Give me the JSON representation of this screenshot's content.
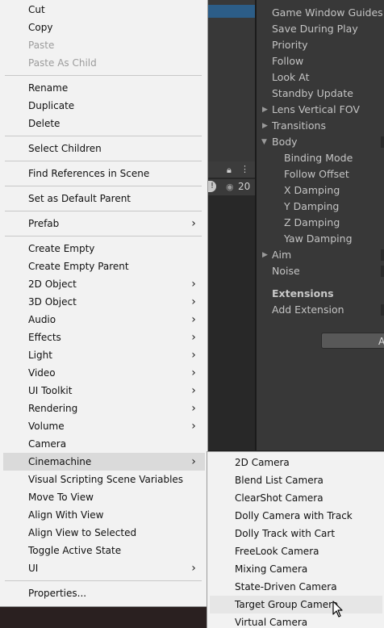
{
  "hierarchy": {
    "visible_count": "20"
  },
  "inspector": {
    "rows": [
      {
        "label": "Game Window Guides"
      },
      {
        "label": "Save During Play"
      },
      {
        "label": "Priority"
      },
      {
        "label": "Follow"
      },
      {
        "label": "Look At"
      },
      {
        "label": "Standby Update"
      },
      {
        "label": "Lens Vertical FOV"
      },
      {
        "label": "Transitions"
      },
      {
        "label": "Body"
      },
      {
        "label": "Binding Mode"
      },
      {
        "label": "Follow Offset"
      },
      {
        "label": "X Damping"
      },
      {
        "label": "Y Damping"
      },
      {
        "label": "Z Damping"
      },
      {
        "label": "Yaw Damping"
      },
      {
        "label": "Aim"
      },
      {
        "label": "Noise"
      },
      {
        "label": "Extensions"
      },
      {
        "label": "Add Extension"
      }
    ],
    "add_button_label": "A"
  },
  "context_menu": {
    "items": [
      {
        "label": "Cut"
      },
      {
        "label": "Copy"
      },
      {
        "label": "Paste"
      },
      {
        "label": "Paste As Child"
      },
      {
        "label": "Rename"
      },
      {
        "label": "Duplicate"
      },
      {
        "label": "Delete"
      },
      {
        "label": "Select Children"
      },
      {
        "label": "Find References in Scene"
      },
      {
        "label": "Set as Default Parent"
      },
      {
        "label": "Prefab"
      },
      {
        "label": "Create Empty"
      },
      {
        "label": "Create Empty Parent"
      },
      {
        "label": "2D Object"
      },
      {
        "label": "3D Object"
      },
      {
        "label": "Audio"
      },
      {
        "label": "Effects"
      },
      {
        "label": "Light"
      },
      {
        "label": "Video"
      },
      {
        "label": "UI Toolkit"
      },
      {
        "label": "Rendering"
      },
      {
        "label": "Volume"
      },
      {
        "label": "Camera"
      },
      {
        "label": "Cinemachine"
      },
      {
        "label": "Visual Scripting Scene Variables"
      },
      {
        "label": "Move To View"
      },
      {
        "label": "Align With View"
      },
      {
        "label": "Align View to Selected"
      },
      {
        "label": "Toggle Active State"
      },
      {
        "label": "UI"
      },
      {
        "label": "Properties..."
      }
    ]
  },
  "cinemachine_submenu": {
    "items": [
      {
        "label": "2D Camera"
      },
      {
        "label": "Blend List Camera"
      },
      {
        "label": "ClearShot Camera"
      },
      {
        "label": "Dolly Camera with Track"
      },
      {
        "label": "Dolly Track with Cart"
      },
      {
        "label": "FreeLook Camera"
      },
      {
        "label": "Mixing Camera"
      },
      {
        "label": "State-Driven Camera"
      },
      {
        "label": "Target Group Camera"
      },
      {
        "label": "Virtual Camera"
      }
    ]
  },
  "icons": {
    "submenu_arrow": "chevron-right-icon",
    "lock": "lock-icon",
    "kebab": "kebab-menu-icon",
    "eye": "eye-icon",
    "foldout": "foldout-triangle-icon",
    "cursor": "mouse-pointer-icon"
  },
  "colors": {
    "menu_bg": "#f2f2f2",
    "selection_blue": "#2c5d87",
    "editor_bg": "#383838"
  }
}
